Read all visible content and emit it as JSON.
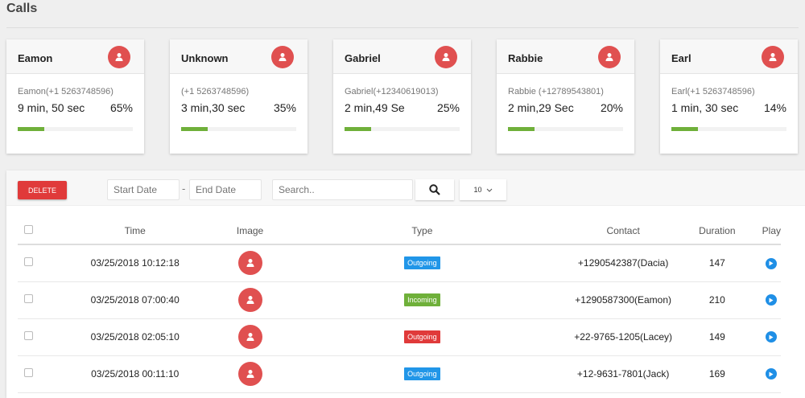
{
  "page_title": "Calls",
  "cards": [
    {
      "name": "Eamon",
      "number": "Eamon(+1 5263748596)",
      "duration": "9 min, 50 sec",
      "percent": "65%"
    },
    {
      "name": "Unknown",
      "number": "(+1 5263748596)",
      "duration": "3 min,30 sec",
      "percent": "35%"
    },
    {
      "name": "Gabriel",
      "number": "Gabriel(+12340619013)",
      "duration": "2 min,49 Se",
      "percent": "25%"
    },
    {
      "name": "Rabbie",
      "number": "Rabbie (+12789543801)",
      "duration": "2 min,29 Sec",
      "percent": "20%"
    },
    {
      "name": "Earl",
      "number": "Earl(+1 5263748596)",
      "duration": "1 min, 30 sec",
      "percent": "14%"
    }
  ],
  "toolbar": {
    "delete_label": "DELETE",
    "start_placeholder": "Start Date",
    "end_placeholder": "End Date",
    "search_placeholder": "Search..",
    "dash": "-",
    "page_size": "10"
  },
  "table": {
    "headers": [
      "Time",
      "Image",
      "Type",
      "Contact",
      "Duration",
      "Play"
    ],
    "rows": [
      {
        "time": "03/25/2018 10:12:18",
        "type": "Outgoing",
        "type_color": "#2196e8",
        "contact": "+1290542387(Dacia)",
        "duration": "147"
      },
      {
        "time": "03/25/2018 07:00:40",
        "type": "Incoming",
        "type_color": "#6fb03a",
        "contact": "+1290587300(Eamon)",
        "duration": "210"
      },
      {
        "time": "03/25/2018 02:05:10",
        "type": "Outgoing",
        "type_color": "#e03a3a",
        "contact": "+22-9765-1205(Lacey)",
        "duration": "149"
      },
      {
        "time": "03/25/2018 00:11:10",
        "type": "Outgoing",
        "type_color": "#2196e8",
        "contact": "+12-9631-7801(Jack)",
        "duration": "169"
      }
    ]
  }
}
